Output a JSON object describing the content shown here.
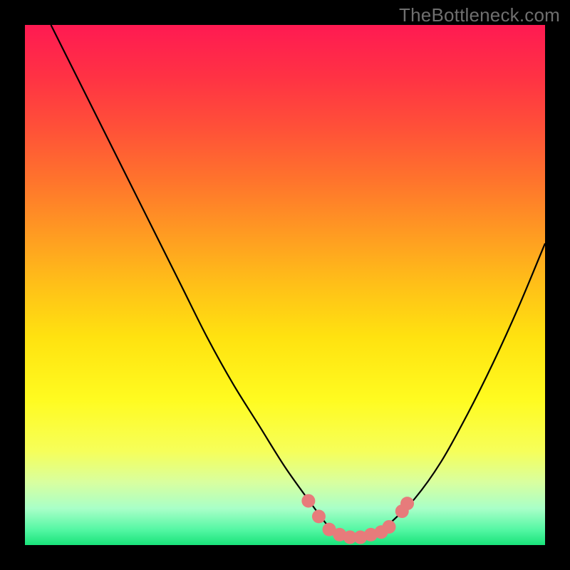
{
  "watermark": {
    "text": "TheBottleneck.com"
  },
  "colors": {
    "bg_black": "#000000",
    "marker_fill": "#e77b7b",
    "curve_stroke": "#000000",
    "gradient_stops": [
      {
        "offset": 0.0,
        "color": "#ff1a52"
      },
      {
        "offset": 0.1,
        "color": "#ff3244"
      },
      {
        "offset": 0.2,
        "color": "#ff5138"
      },
      {
        "offset": 0.3,
        "color": "#ff742c"
      },
      {
        "offset": 0.4,
        "color": "#ff9a22"
      },
      {
        "offset": 0.5,
        "color": "#ffc018"
      },
      {
        "offset": 0.6,
        "color": "#ffe210"
      },
      {
        "offset": 0.72,
        "color": "#fffb20"
      },
      {
        "offset": 0.82,
        "color": "#f6ff5a"
      },
      {
        "offset": 0.88,
        "color": "#d8ffa0"
      },
      {
        "offset": 0.93,
        "color": "#a8ffc8"
      },
      {
        "offset": 0.97,
        "color": "#55f7a4"
      },
      {
        "offset": 1.0,
        "color": "#19e37a"
      }
    ]
  },
  "chart_data": {
    "type": "line",
    "title": "",
    "xlabel": "",
    "ylabel": "",
    "xlim": [
      0,
      100
    ],
    "ylim": [
      0,
      100
    ],
    "grid": false,
    "legend": false,
    "series": [
      {
        "name": "bottleneck-curve",
        "x": [
          5,
          10,
          15,
          20,
          25,
          30,
          35,
          40,
          45,
          50,
          55,
          58,
          60,
          62,
          65,
          68,
          70,
          75,
          80,
          85,
          90,
          95,
          100
        ],
        "y": [
          100,
          90,
          80,
          70,
          60,
          50,
          40,
          31,
          23,
          15,
          8,
          4,
          2,
          1,
          1,
          2,
          4,
          9,
          16,
          25,
          35,
          46,
          58
        ]
      }
    ],
    "markers": {
      "name": "optimal-range",
      "points": [
        {
          "x": 54.5,
          "y": 8.5
        },
        {
          "x": 56.5,
          "y": 5.5
        },
        {
          "x": 58.5,
          "y": 3.0
        },
        {
          "x": 60.5,
          "y": 2.0
        },
        {
          "x": 62.5,
          "y": 1.5
        },
        {
          "x": 64.5,
          "y": 1.5
        },
        {
          "x": 66.5,
          "y": 2.0
        },
        {
          "x": 68.5,
          "y": 2.5
        },
        {
          "x": 70.0,
          "y": 3.5
        },
        {
          "x": 72.5,
          "y": 6.5
        },
        {
          "x": 73.5,
          "y": 8.0
        }
      ]
    }
  }
}
